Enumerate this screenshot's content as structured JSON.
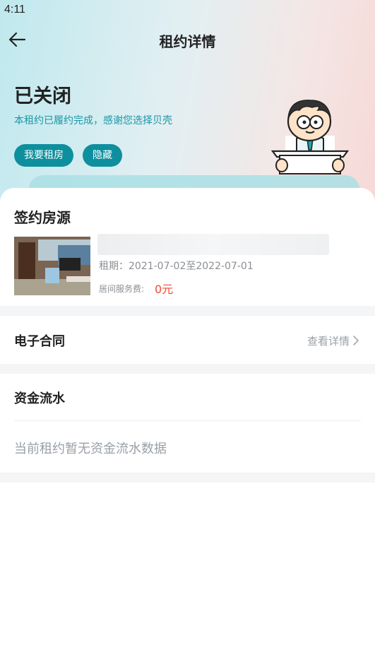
{
  "status_bar": {
    "time": "4:11"
  },
  "header": {
    "title": "租约详情",
    "back_icon": "arrow-left-icon"
  },
  "status": {
    "title": "已关闭",
    "description": "本租约已履约完成，感谢您选择贝壳",
    "buttons": [
      "我要租房",
      "隐藏"
    ]
  },
  "property": {
    "section_title": "签约房源",
    "lease_term": "租期：2021-07-02至2022-07-01",
    "service_fee_label": "居间服务费:",
    "service_fee_value": "0元"
  },
  "contract": {
    "title": "电子合同",
    "link_label": "查看详情"
  },
  "cashflow": {
    "title": "资金流水",
    "empty_text": "当前租约暂无资金流水数据"
  },
  "colors": {
    "accent": "#0e8f9e",
    "fee": "#f04a3a",
    "muted": "#9aa0a6"
  }
}
